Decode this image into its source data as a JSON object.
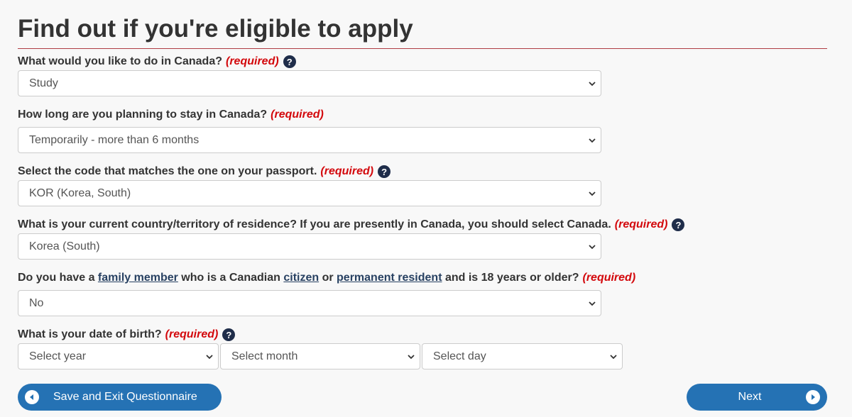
{
  "page": {
    "title": "Find out if you're eligible to apply"
  },
  "questions": [
    {
      "text": "What would you like to do in Canada?",
      "required": "(required)",
      "has_help": true,
      "value": "Study"
    },
    {
      "text": "How long are you planning to stay in Canada?",
      "required": "(required)",
      "has_help": false,
      "value": "Temporarily - more than 6 months"
    },
    {
      "text": "Select the code that matches the one on your passport.",
      "required": "(required)",
      "has_help": true,
      "value": "KOR (Korea, South)"
    },
    {
      "text": "What is your current country/territory of residence? If you are presently in Canada, you should select Canada.",
      "required": "(required)",
      "has_help": true,
      "value": "Korea (South)"
    },
    {
      "text_parts": [
        "Do you have a ",
        "family member",
        " who is a Canadian ",
        "citizen",
        " or ",
        "permanent resident",
        " and is 18 years or older?"
      ],
      "required": "(required)",
      "has_help": false,
      "value": "No"
    },
    {
      "text": "What is your date of birth?",
      "required": "(required)",
      "has_help": true,
      "year_value": "Select year",
      "month_value": "Select month",
      "day_value": "Select day"
    }
  ],
  "help_glyph": "?",
  "buttons": {
    "save_exit_label": "Save and Exit Questionnaire",
    "next_label": "Next"
  },
  "colors": {
    "accent_blue": "#2572b4",
    "required_red": "#d3080c",
    "rule_red": "#af3c43",
    "link_navy": "#284162",
    "help_icon": "#1f2d4a"
  },
  "icons": {
    "help": "question-circle-icon",
    "select_arrow": "chevron-down-icon",
    "save_exit": "arrow-left-circle-icon",
    "next": "arrow-right-circle-icon"
  }
}
